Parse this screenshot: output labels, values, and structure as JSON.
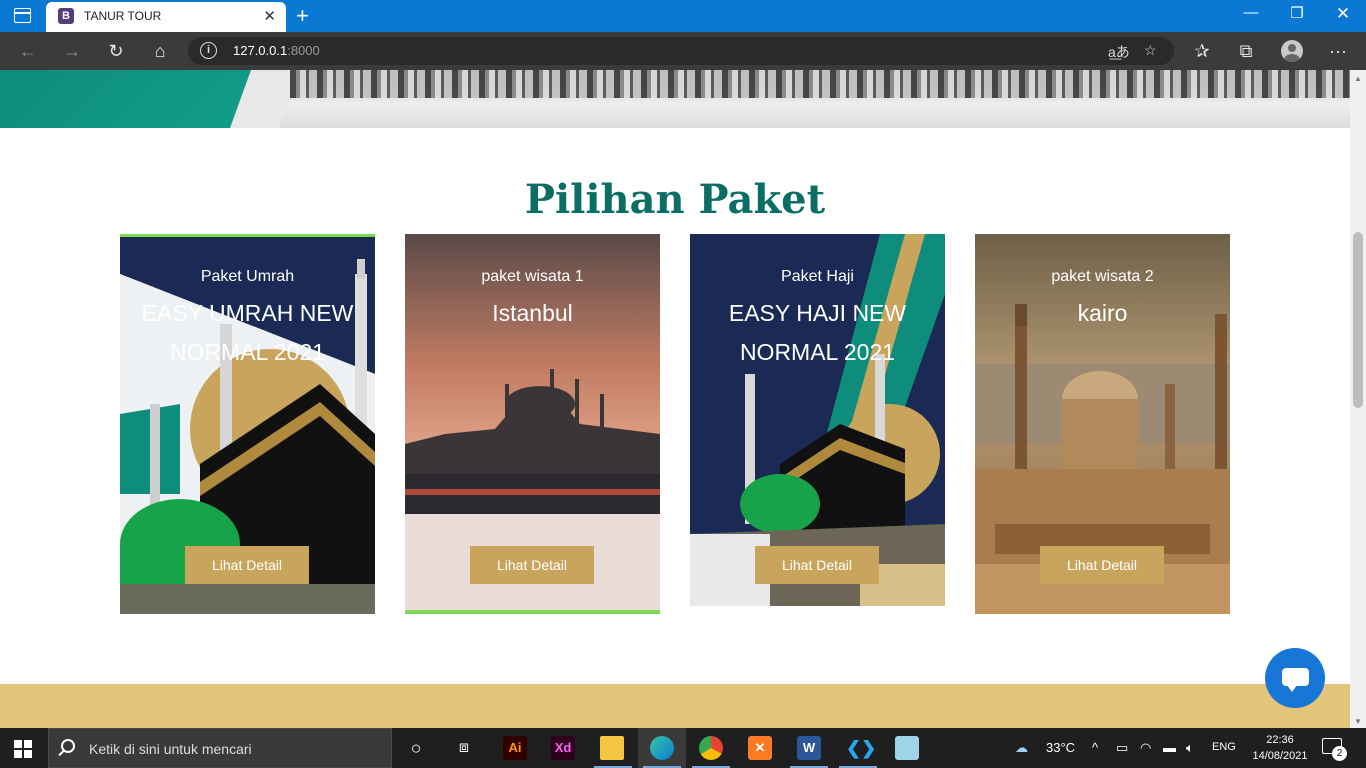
{
  "browser": {
    "tab_title": "TANUR TOUR",
    "tab_favicon": "B",
    "url_host": "127.0.0.1",
    "url_port": ":8000"
  },
  "page": {
    "section_title": "Pilihan Paket",
    "cards": [
      {
        "category": "Paket Umrah",
        "name": "EASY UMRAH NEW NORMAL 2021",
        "button": "Lihat Detail"
      },
      {
        "category": "paket wisata 1",
        "name": "Istanbul",
        "button": "Lihat Detail"
      },
      {
        "category": "Paket Haji",
        "name": "EASY HAJI NEW NORMAL 2021",
        "button": "Lihat Detail"
      },
      {
        "category": "paket wisata 2",
        "name": "kairo",
        "button": "Lihat Detail"
      }
    ]
  },
  "taskbar": {
    "search_placeholder": "Ketik di sini untuk mencari",
    "apps": [
      "task-view",
      "illustrator",
      "adobe-xd",
      "file-explorer",
      "edge",
      "chrome",
      "xampp",
      "word",
      "vscode",
      "notepad"
    ],
    "weather": "33°C",
    "language": "ENG",
    "time": "22:36",
    "date": "14/08/2021",
    "notification_count": "2"
  },
  "colors": {
    "titlebar": "#0b78d4",
    "toolbar": "#3b3b3b",
    "accent_teal": "#0a6e64",
    "button_gold": "#c9a45c",
    "band_gold": "#e3c57a",
    "chat_blue": "#1877d6"
  }
}
